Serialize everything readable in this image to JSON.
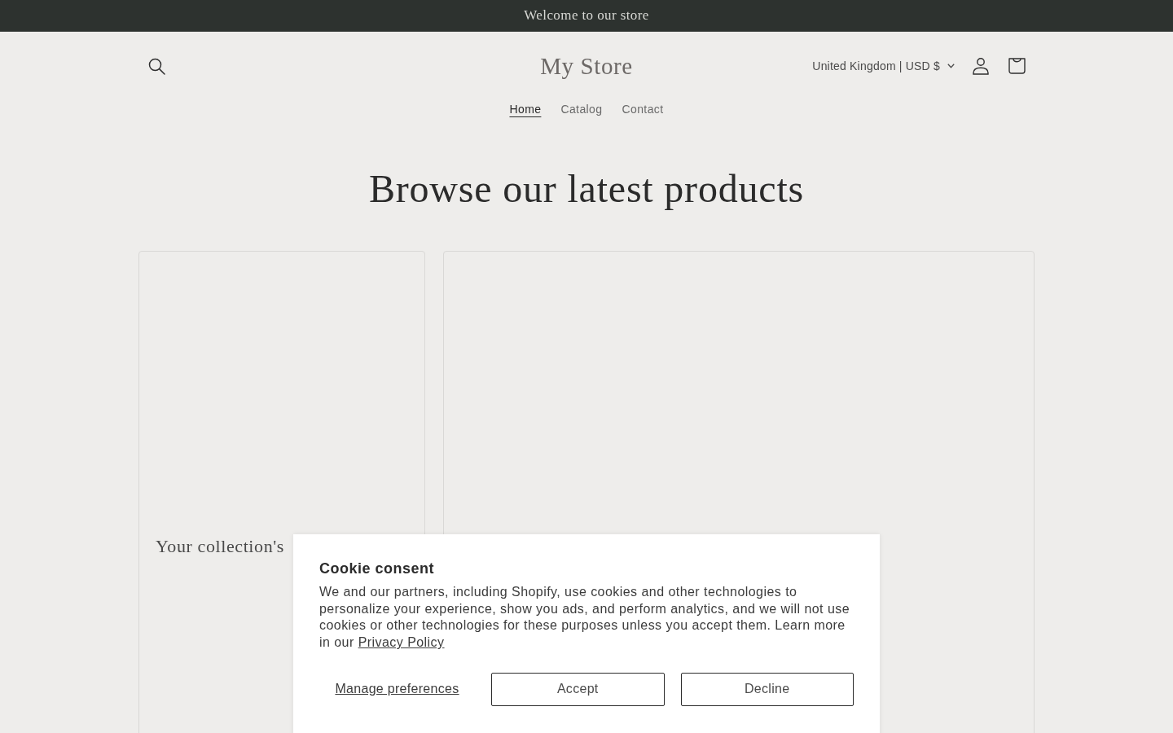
{
  "announcement_bar": {
    "text": "Welcome to our store"
  },
  "header": {
    "logo": "My Store",
    "country_selector": "United Kingdom | USD $",
    "nav": [
      {
        "label": "Home",
        "selected": true
      },
      {
        "label": "Catalog",
        "selected": false
      },
      {
        "label": "Contact",
        "selected": false
      }
    ]
  },
  "section": {
    "heading": "Browse our latest products",
    "cards": [
      {
        "kind": "titled",
        "title": "Your collection's"
      },
      {
        "kind": "plain"
      }
    ]
  },
  "cookie_banner": {
    "title": "Cookie consent",
    "text": "We and our partners, including Shopify, use cookies and other technologies to personalize your experience, show you ads, and perform analytics, and we will not use cookies or other technologies for these purposes unless you accept them. Learn more in our",
    "link": "Privacy Policy",
    "manage_link": "Manage preferences",
    "buttons": [
      "Accept",
      "Decline"
    ]
  }
}
